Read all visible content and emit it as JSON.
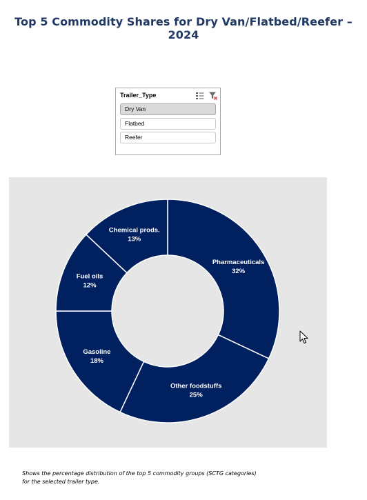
{
  "title": "Top 5 Commodity Shares for Dry Van/Flatbed/Reefer – 2024",
  "slicer": {
    "title": "Trailer_Type",
    "icons": [
      "multi-select-icon",
      "clear-filter-icon"
    ],
    "items": [
      {
        "label": "Dry Van",
        "selected": true
      },
      {
        "label": "Flatbed",
        "selected": false
      },
      {
        "label": "Reefer",
        "selected": false
      }
    ]
  },
  "chart_data": {
    "type": "pie",
    "variant": "doughnut",
    "slices": [
      {
        "label": "Pharmaceuticals",
        "value": 32,
        "display": "32%"
      },
      {
        "label": "Other foodstuffs",
        "value": 25,
        "display": "25%"
      },
      {
        "label": "Gasoline",
        "value": 18,
        "display": "18%"
      },
      {
        "label": "Fuel oils",
        "value": 12,
        "display": "12%"
      },
      {
        "label": "Chemical prods.",
        "value": 13,
        "display": "13%"
      }
    ],
    "colors": {
      "slice": "#002060",
      "separator": "#ffffff",
      "background": "#e6e6e6",
      "label": "#ffffff"
    }
  },
  "footnote": {
    "line1": "Shows the percentage distribution of the top 5 commodity groups (SCTG categories)",
    "line2": "for the selected trailer type."
  },
  "colors": {
    "title": "#1f3864",
    "slicer_selected": "#dadada",
    "slicer_border": "#a6a6a6"
  }
}
